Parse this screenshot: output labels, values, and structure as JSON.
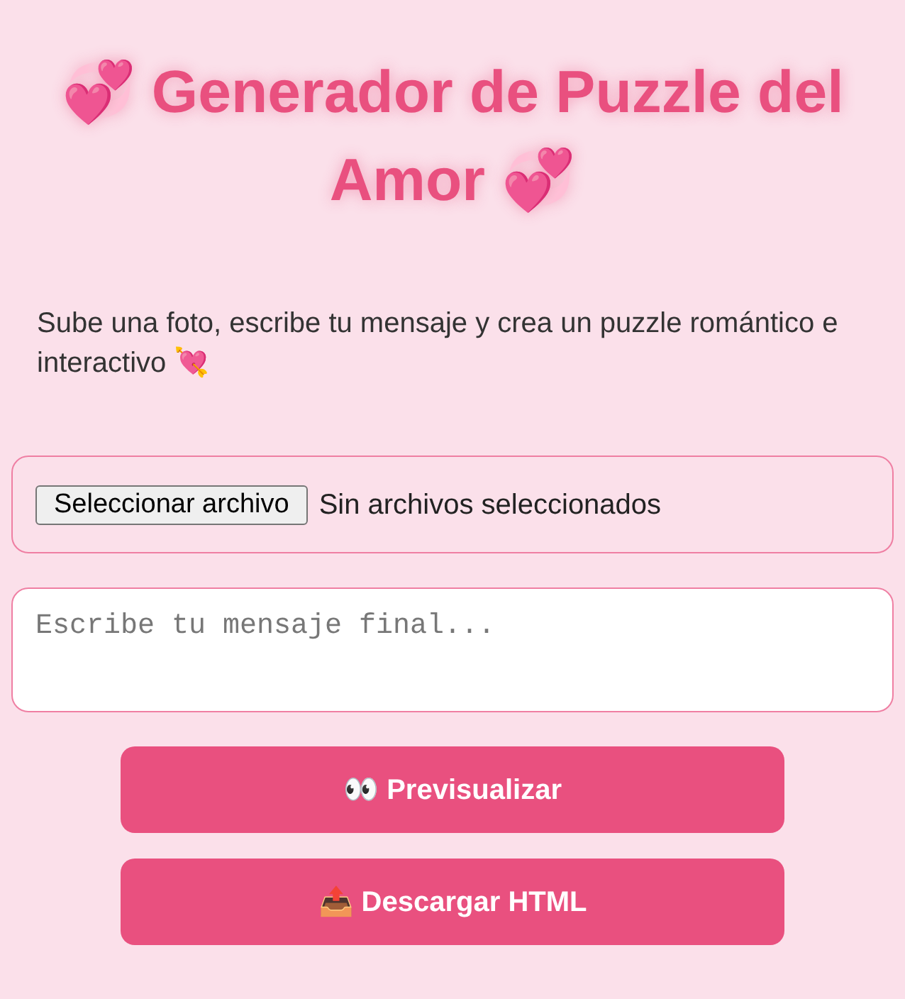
{
  "title": "💞 Generador de Puzzle del Amor 💞",
  "intro": "Sube una foto, escribe tu mensaje y crea un puzzle romántico e interactivo 💘",
  "file_picker": {
    "button": "Seleccionar archivo",
    "status": "Sin archivos seleccionados"
  },
  "message": {
    "placeholder": "Escribe tu mensaje final..."
  },
  "buttons": [
    "👀 Previsualizar",
    "📤 Descargar HTML"
  ]
}
